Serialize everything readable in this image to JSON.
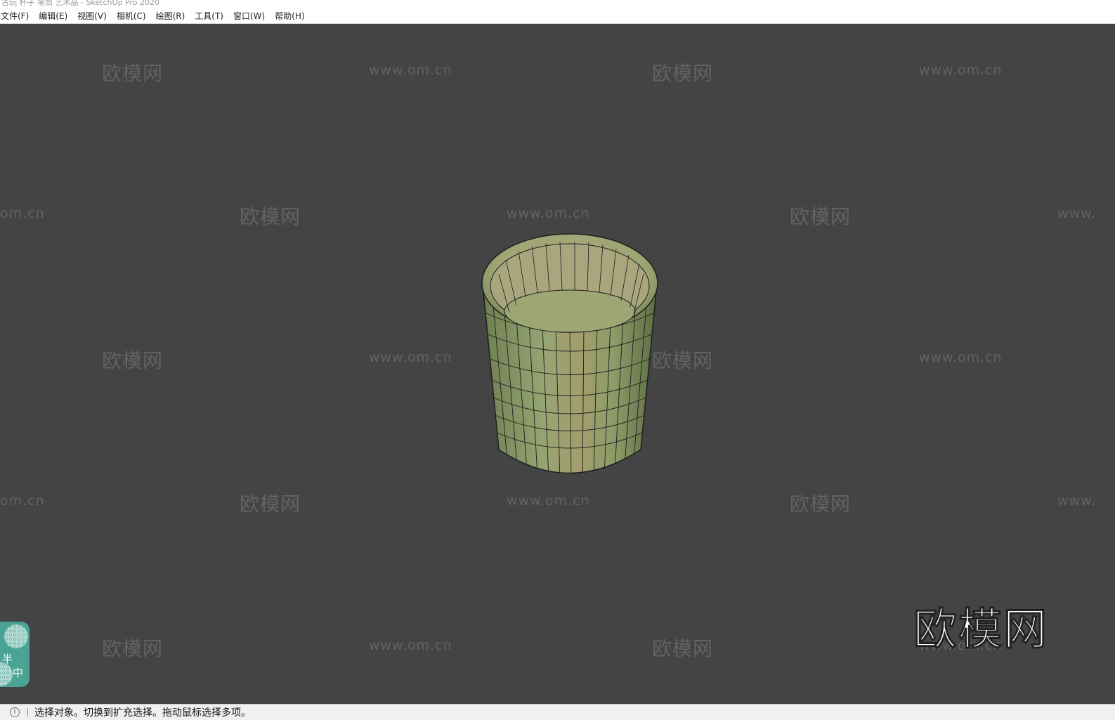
{
  "window": {
    "title": "古玩 杯子 笔筒 艺术品 - SketchUp Pro 2020"
  },
  "menubar": {
    "items": [
      {
        "label": "文件(F)"
      },
      {
        "label": "编辑(E)"
      },
      {
        "label": "视图(V)"
      },
      {
        "label": "相机(C)"
      },
      {
        "label": "绘图(R)"
      },
      {
        "label": "工具(T)"
      },
      {
        "label": "窗口(W)"
      },
      {
        "label": "帮助(H)"
      }
    ]
  },
  "watermark": {
    "cn": "欧模网",
    "en": "www.om.cn",
    "partial_en_left": "om.cn",
    "partial_en_right": "www."
  },
  "logo": {
    "text": "欧模网"
  },
  "badge": {
    "char1": "半",
    "char2": "中"
  },
  "statusbar": {
    "icon": "info-icon",
    "text": "选择对象。切换到扩充选择。拖动鼠标选择多项。"
  },
  "colors": {
    "viewport": "#444444",
    "cup_body": "#8a9a68",
    "cup_inner": "#a8a47a",
    "badge": "#4aa394"
  }
}
